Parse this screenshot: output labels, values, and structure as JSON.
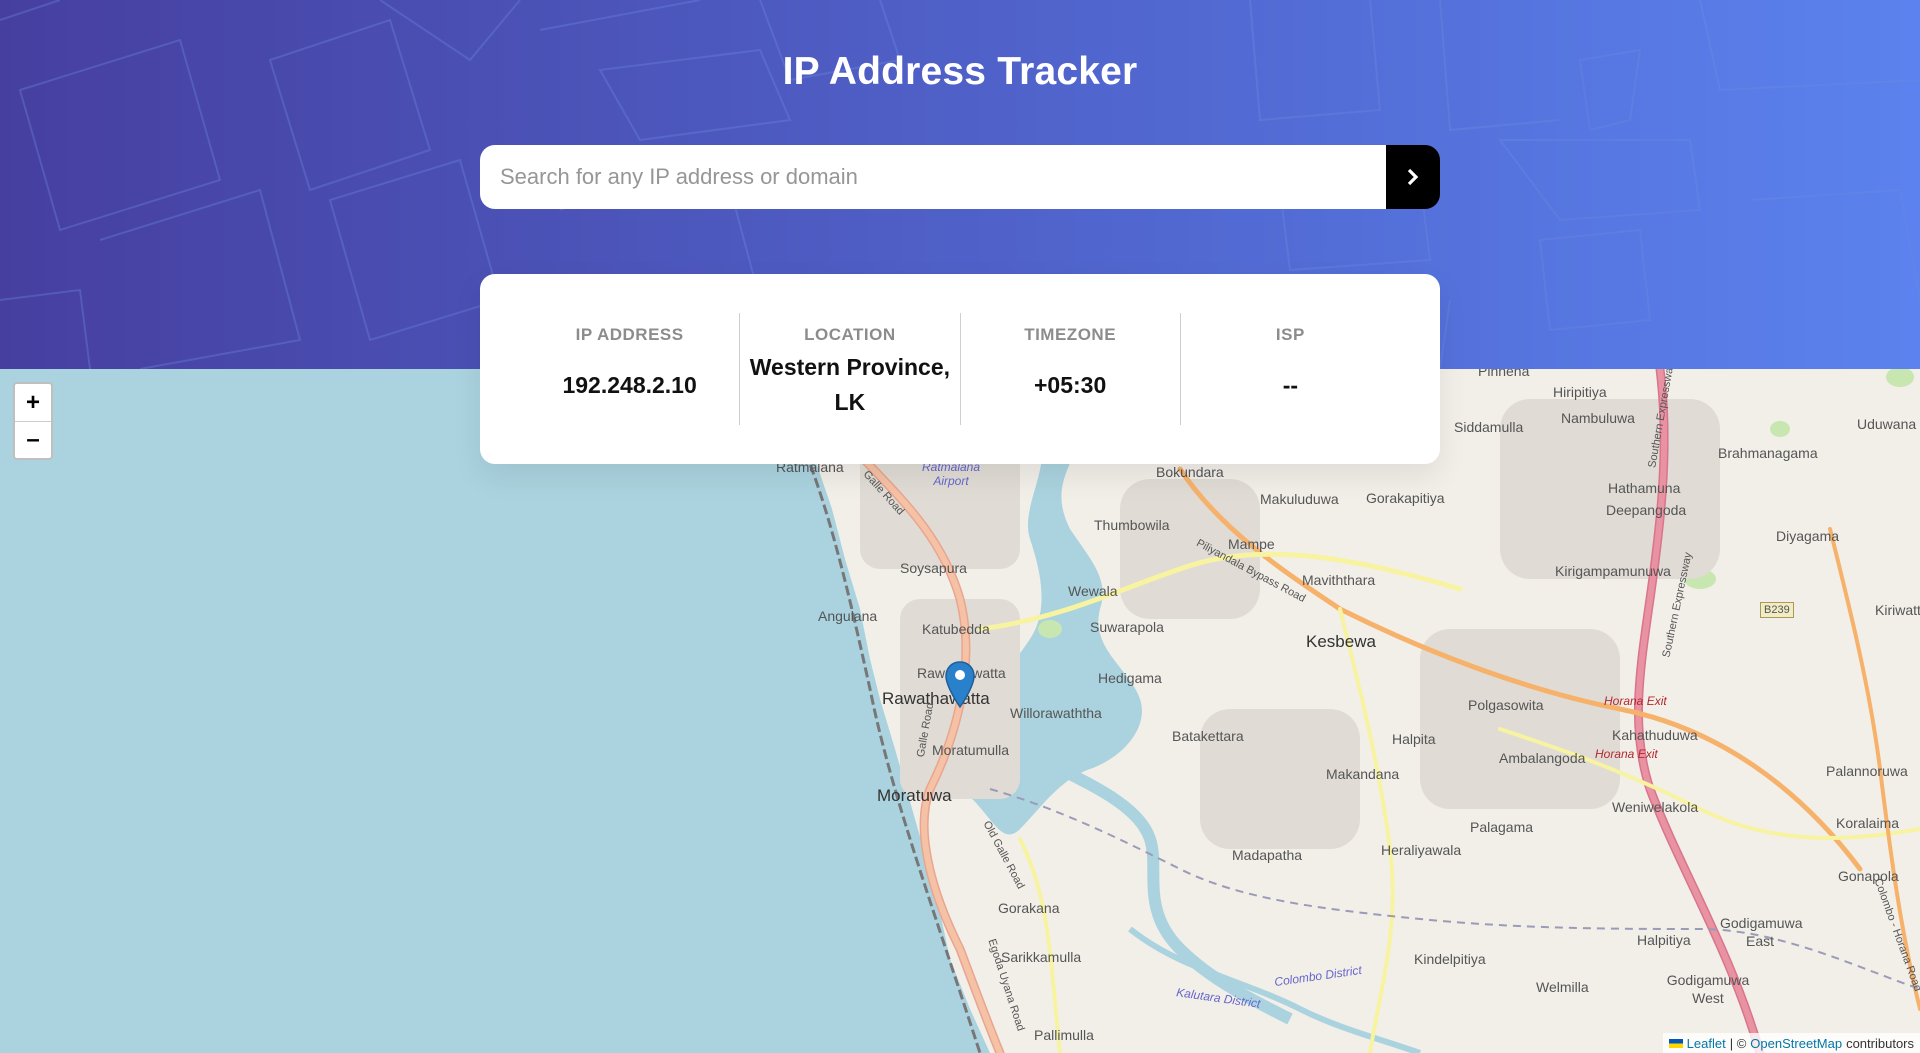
{
  "header": {
    "title": "IP Address Tracker"
  },
  "search": {
    "placeholder": "Search for any IP address or domain",
    "value": "",
    "submit_icon": "chevron-right-icon"
  },
  "info": {
    "ip_label": "IP ADDRESS",
    "ip_value": "192.248.2.10",
    "location_label": "LOCATION",
    "location_value": "Western Province, LK",
    "timezone_label": "TIMEZONE",
    "timezone_value": "+05:30",
    "isp_label": "ISP",
    "isp_value": "--"
  },
  "map": {
    "zoom_in": "+",
    "zoom_out": "–",
    "marker_icon": "map-marker-icon",
    "places": {
      "ratmalana": "Ratmalana",
      "ratmalana_airport": "Ratmalana Airport",
      "bokundara": "Bokundara",
      "makuluduwa": "Makuluduwa",
      "gorakapitiya": "Gorakapitiya",
      "pinnena": "Pinnena",
      "hiripitiya": "Hiripitiya",
      "siddamulla": "Siddamulla",
      "nambuluwa": "Nambuluwa",
      "brahmanagama": "Brahmanagama",
      "uduwana": "Uduwana",
      "hathamuna": "Hathamuna",
      "deepangoda": "Deepangoda",
      "diyagama": "Diyagama",
      "thumbowila": "Thumbowila",
      "mampe": "Mampe",
      "soysapura": "Soysapura",
      "maviththara": "Maviththara",
      "kirigampamunuwa": "Kirigampamunuwa",
      "wewala": "Wewala",
      "angulana": "Angulana",
      "katubedda": "Katubedda",
      "suwarapola": "Suwarapola",
      "kesbewa": "Kesbewa",
      "kiriwattuduwa": "Kiriwattu",
      "rawathawatta_small": "Rawathawatta",
      "rawathawatta": "Rawathawatta",
      "hedigama": "Hedigama",
      "polgasowita": "Polgasowita",
      "willorawaththa": "Willorawaththa",
      "moratumulla": "Moratumulla",
      "batakettara": "Batakettara",
      "halpita": "Halpita",
      "kahathuduwa": "Kahathuduwa",
      "ambalangoda": "Ambalangoda",
      "palannoruwa": "Palannoruwa",
      "makandana": "Makandana",
      "moratuwa": "Moratuwa",
      "weniwelakola": "Weniwelakola",
      "koralaima": "Koralaima",
      "palagama": "Palagama",
      "heraliyawala": "Heraliyawala",
      "madapatha": "Madapatha",
      "gonapola": "Gonapola",
      "gorakana": "Gorakana",
      "godigamuwa_east": "Godigamuwa East",
      "halpitiya": "Halpitiya",
      "sarikkamulla": "Sarikkamulla",
      "kindelpitiya": "Kindelpitiya",
      "godigamuwa_west": "Godigamuwa West",
      "welmilla": "Welmilla",
      "pallimulla": "Pallimulla",
      "colombo_district": "Colombo District",
      "kalutara_district": "Kalutara District",
      "horana_exit_1": "Horana Exit",
      "horana_exit_2": "Horana Exit",
      "galle_road_1": "Galle Road",
      "galle_road_2": "Galle Road",
      "old_galle_road": "Old Galle Road",
      "egoda_uyana_road": "Egoda Uyana Road",
      "piliyandala_bypass": "Piliyandala Bypass Road",
      "southern_expressway_1": "Southern Expressway",
      "southern_expressway_2": "Southern Expressway",
      "colombo_horana_road": "Colombo - Horana Road",
      "b239": "B239"
    },
    "attribution": {
      "leaflet": "Leaflet",
      "separator": "| ©",
      "osm": "OpenStreetMap",
      "contributors": "contributors"
    }
  }
}
